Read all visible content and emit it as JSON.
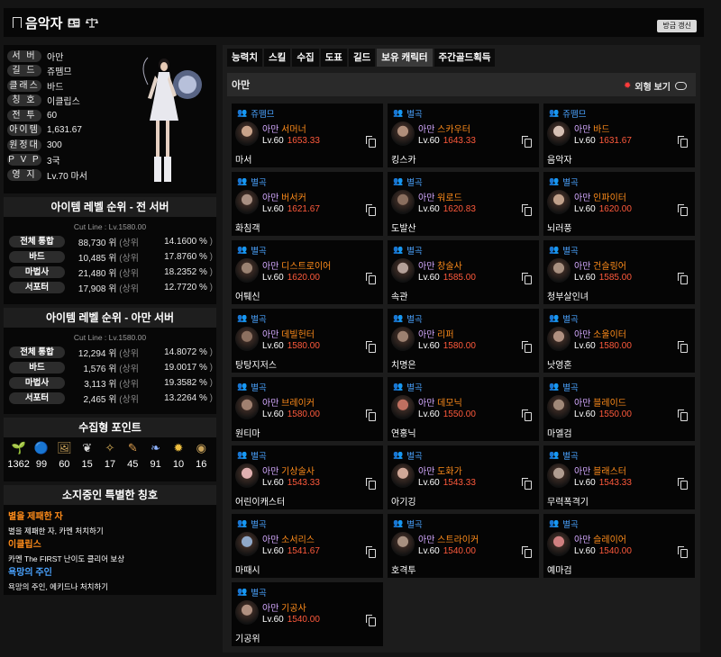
{
  "header": {
    "title": "음악자",
    "refresh_label": "방금 갱신"
  },
  "profile": {
    "rows": [
      {
        "label": "서 버",
        "value": "아만"
      },
      {
        "label": "길 드",
        "value": "쥬뗌므"
      },
      {
        "label": "클래스",
        "value": "바드"
      },
      {
        "label": "칭 호",
        "value": "이클립스"
      },
      {
        "label": "전 투",
        "value": "60"
      },
      {
        "label": "아이템",
        "value": "1,631.67"
      },
      {
        "label": "원정대",
        "value": "300"
      },
      {
        "label": "P V P",
        "value": "3국"
      },
      {
        "label": "영 지",
        "value": "Lv.70 마서"
      }
    ]
  },
  "rank_all": {
    "title": "아이템 레벨 순위 - 전 서버",
    "cutline": "Cut Line : Lv.1580.00",
    "rows": [
      {
        "label": "전체 통합",
        "rank": "88,730 위",
        "pct": "14.1600 %"
      },
      {
        "label": "바드",
        "rank": "10,485 위",
        "pct": "17.8760 %"
      },
      {
        "label": "마법사",
        "rank": "21,480 위",
        "pct": "18.2352 %"
      },
      {
        "label": "서포터",
        "rank": "17,908 위",
        "pct": "12.7720 %"
      }
    ],
    "pct_prefix": "(상위",
    "pct_suffix": ")"
  },
  "rank_server": {
    "title": "아이템 레벨 순위 - 아만 서버",
    "cutline": "Cut Line : Lv.1580.00",
    "rows": [
      {
        "label": "전체 통합",
        "rank": "12,294 위",
        "pct": "14.8072 %"
      },
      {
        "label": "바드",
        "rank": "1,576 위",
        "pct": "19.0017 %"
      },
      {
        "label": "마법사",
        "rank": "3,113 위",
        "pct": "19.3582 %"
      },
      {
        "label": "서포터",
        "rank": "2,465 위",
        "pct": "13.2264 %"
      }
    ]
  },
  "collect": {
    "title": "수집형 포인트",
    "items": [
      {
        "icon": "mokoko-seed-icon",
        "glyph": "🌱",
        "value": "1362"
      },
      {
        "icon": "island-heart-icon",
        "glyph": "🔵",
        "value": "99"
      },
      {
        "icon": "great-art-icon",
        "glyph": "🖼",
        "value": "60"
      },
      {
        "icon": "giant-heart-icon",
        "glyph": "❦",
        "value": "15"
      },
      {
        "icon": "ignea-token-icon",
        "glyph": "✧",
        "value": "17"
      },
      {
        "icon": "adventure-book-icon",
        "glyph": "✎",
        "value": "45"
      },
      {
        "icon": "world-tree-leaf-icon",
        "glyph": "❧",
        "value": "91"
      },
      {
        "icon": "orpheus-star-icon",
        "glyph": "✹",
        "value": "10"
      },
      {
        "icon": "orpheus-disc-icon",
        "glyph": "◉",
        "value": "16"
      }
    ]
  },
  "titles": {
    "title": "소지중인 특별한 칭호",
    "items": [
      {
        "name": "별을 제패한 자",
        "desc": "별을 제패한 자, 카멘 처치하기",
        "color": "#ff8c1a"
      },
      {
        "name": "이클립스",
        "desc": "카멘 The FIRST 난이도 클리어 보상",
        "color": "#ff8c1a"
      },
      {
        "name": "욕망의 주인",
        "desc": "욕망의 주인, 에키드나 처치하기",
        "color": "#4aa3ff"
      }
    ]
  },
  "tabs": [
    "능력치",
    "스킬",
    "수집",
    "도표",
    "길드",
    "보유 캐릭터",
    "주간골드획득"
  ],
  "active_tab": 5,
  "server_section": {
    "name": "아만",
    "appearance_label": "외형 보기"
  },
  "characters": [
    {
      "guild": "쥬뗌므",
      "server": "아만",
      "cls": "서머너",
      "lv": "Lv.60",
      "ilvl": "1653.33",
      "nick": "마서"
    },
    {
      "guild": "별곡",
      "server": "아만",
      "cls": "스카우터",
      "lv": "Lv.60",
      "ilvl": "1643.33",
      "nick": "킹스카"
    },
    {
      "guild": "쥬뗌므",
      "server": "아만",
      "cls": "바드",
      "lv": "Lv.60",
      "ilvl": "1631.67",
      "nick": "음악자"
    },
    {
      "guild": "별곡",
      "server": "아만",
      "cls": "버서커",
      "lv": "Lv.60",
      "ilvl": "1621.67",
      "nick": "화침객"
    },
    {
      "guild": "별곡",
      "server": "아만",
      "cls": "워로드",
      "lv": "Lv.60",
      "ilvl": "1620.83",
      "nick": "도발산"
    },
    {
      "guild": "별곡",
      "server": "아만",
      "cls": "인파이터",
      "lv": "Lv.60",
      "ilvl": "1620.00",
      "nick": "뇌러풍"
    },
    {
      "guild": "별곡",
      "server": "아만",
      "cls": "디스트로이어",
      "lv": "Lv.60",
      "ilvl": "1620.00",
      "nick": "어퉤신"
    },
    {
      "guild": "별곡",
      "server": "아만",
      "cls": "창술사",
      "lv": "Lv.60",
      "ilvl": "1585.00",
      "nick": "속관"
    },
    {
      "guild": "별곡",
      "server": "아만",
      "cls": "건슬링어",
      "lv": "Lv.60",
      "ilvl": "1585.00",
      "nick": "청부살인녀"
    },
    {
      "guild": "별곡",
      "server": "아만",
      "cls": "데빌헌터",
      "lv": "Lv.60",
      "ilvl": "1580.00",
      "nick": "탕탕지저스"
    },
    {
      "guild": "별곡",
      "server": "아만",
      "cls": "리퍼",
      "lv": "Lv.60",
      "ilvl": "1580.00",
      "nick": "치명은"
    },
    {
      "guild": "별곡",
      "server": "아만",
      "cls": "소울이터",
      "lv": "Lv.60",
      "ilvl": "1580.00",
      "nick": "낫영혼"
    },
    {
      "guild": "별곡",
      "server": "아만",
      "cls": "브레이커",
      "lv": "Lv.60",
      "ilvl": "1580.00",
      "nick": "원티마"
    },
    {
      "guild": "별곡",
      "server": "아만",
      "cls": "데모닉",
      "lv": "Lv.60",
      "ilvl": "1550.00",
      "nick": "연홍닉"
    },
    {
      "guild": "별곡",
      "server": "아만",
      "cls": "블레이드",
      "lv": "Lv.60",
      "ilvl": "1550.00",
      "nick": "마엘검"
    },
    {
      "guild": "별곡",
      "server": "아만",
      "cls": "기상술사",
      "lv": "Lv.60",
      "ilvl": "1543.33",
      "nick": "어린이캐스터"
    },
    {
      "guild": "별곡",
      "server": "아만",
      "cls": "도화가",
      "lv": "Lv.60",
      "ilvl": "1543.33",
      "nick": "아기깅"
    },
    {
      "guild": "별곡",
      "server": "아만",
      "cls": "블래스터",
      "lv": "Lv.60",
      "ilvl": "1543.33",
      "nick": "무력폭격기"
    },
    {
      "guild": "별곡",
      "server": "아만",
      "cls": "소서리스",
      "lv": "Lv.60",
      "ilvl": "1541.67",
      "nick": "마때시"
    },
    {
      "guild": "별곡",
      "server": "아만",
      "cls": "스트라이커",
      "lv": "Lv.60",
      "ilvl": "1540.00",
      "nick": "호격투"
    },
    {
      "guild": "별곡",
      "server": "아만",
      "cls": "슬레이어",
      "lv": "Lv.60",
      "ilvl": "1540.00",
      "nick": "예마검"
    },
    {
      "guild": "별곡",
      "server": "아만",
      "cls": "기공사",
      "lv": "Lv.60",
      "ilvl": "1540.00",
      "nick": "기공위"
    }
  ],
  "colors": {
    "accent_orange": "#ff8c1a",
    "guild_blue": "#4aa3ff",
    "item_level_red": "#ff5a3c",
    "server_purple": "#d4a9ff"
  }
}
